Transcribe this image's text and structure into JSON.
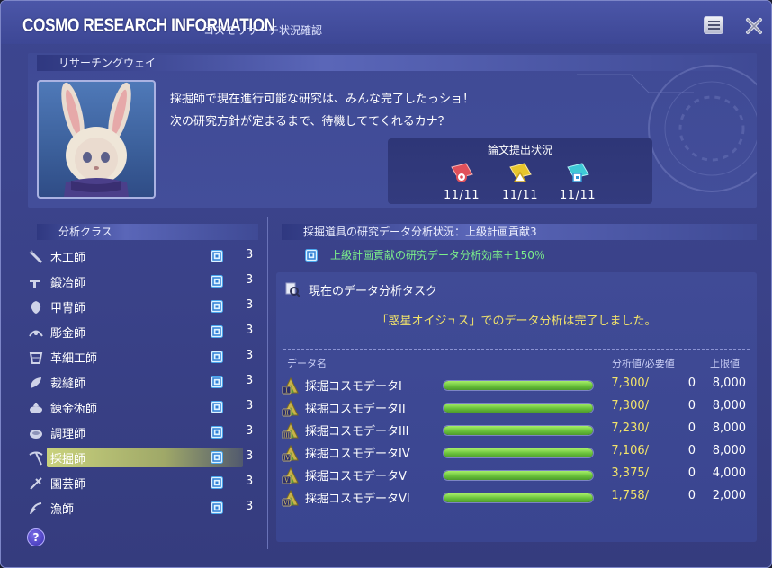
{
  "window": {
    "title": "COSMO RESEARCH INFORMATION",
    "subtitle": "コスモリサーチ状況確認"
  },
  "research_way": {
    "header": "リサーチングウェイ",
    "dialogue": [
      "採掘師で現在進行可能な研究は、みんな完了したっショ！",
      "次の研究方針が定まるまで、待機しててくれるカナ？"
    ],
    "papers": {
      "title": "論文提出状況",
      "items": [
        {
          "count": "11/11",
          "color": "#e0505a",
          "icon": "red-paper-icon"
        },
        {
          "count": "11/11",
          "color": "#e8c62c",
          "icon": "yellow-paper-icon"
        },
        {
          "count": "11/11",
          "color": "#3ec9d6",
          "icon": "cyan-paper-icon"
        }
      ]
    }
  },
  "classes": {
    "header": "分析クラス",
    "items": [
      {
        "name": "木工師",
        "level": "3",
        "icon": "carpenter-icon"
      },
      {
        "name": "鍛冶師",
        "level": "3",
        "icon": "blacksmith-icon"
      },
      {
        "name": "甲冑師",
        "level": "3",
        "icon": "armorer-icon"
      },
      {
        "name": "彫金師",
        "level": "3",
        "icon": "goldsmith-icon"
      },
      {
        "name": "革細工師",
        "level": "3",
        "icon": "leatherworker-icon"
      },
      {
        "name": "裁縫師",
        "level": "3",
        "icon": "weaver-icon"
      },
      {
        "name": "錬金術師",
        "level": "3",
        "icon": "alchemist-icon"
      },
      {
        "name": "調理師",
        "level": "3",
        "icon": "culinarian-icon"
      },
      {
        "name": "採掘師",
        "level": "3",
        "icon": "miner-icon",
        "selected": true
      },
      {
        "name": "園芸師",
        "level": "3",
        "icon": "botanist-icon"
      },
      {
        "name": "漁師",
        "level": "3",
        "icon": "fisher-icon"
      }
    ]
  },
  "analysis": {
    "header": "採掘道具の研究データ分析状況：上級計画貢献3",
    "status": "上級計画貢献の研究データ分析効率＋150％",
    "task_title": "現在のデータ分析タスク",
    "message": "「惑星オイジュス」でのデータ分析は完了しました。",
    "columns": {
      "name": "データ名",
      "value": "分析値/必要値",
      "max": "上限値"
    },
    "rows": [
      {
        "name": "採掘コスモデータI",
        "value": "7,300/",
        "required": "0",
        "max": "8,000",
        "ratio": 1.0,
        "badge": "I"
      },
      {
        "name": "採掘コスモデータII",
        "value": "7,300/",
        "required": "0",
        "max": "8,000",
        "ratio": 1.0,
        "badge": "II"
      },
      {
        "name": "採掘コスモデータIII",
        "value": "7,230/",
        "required": "0",
        "max": "8,000",
        "ratio": 1.0,
        "badge": "III"
      },
      {
        "name": "採掘コスモデータIV",
        "value": "7,106/",
        "required": "0",
        "max": "8,000",
        "ratio": 1.0,
        "badge": "IV"
      },
      {
        "name": "採掘コスモデータV",
        "value": "3,375/",
        "required": "0",
        "max": "4,000",
        "ratio": 1.0,
        "badge": "V"
      },
      {
        "name": "採掘コスモデータVI",
        "value": "1,758/",
        "required": "0",
        "max": "2,000",
        "ratio": 1.0,
        "badge": "VI"
      }
    ]
  },
  "help": {
    "label": "?"
  }
}
